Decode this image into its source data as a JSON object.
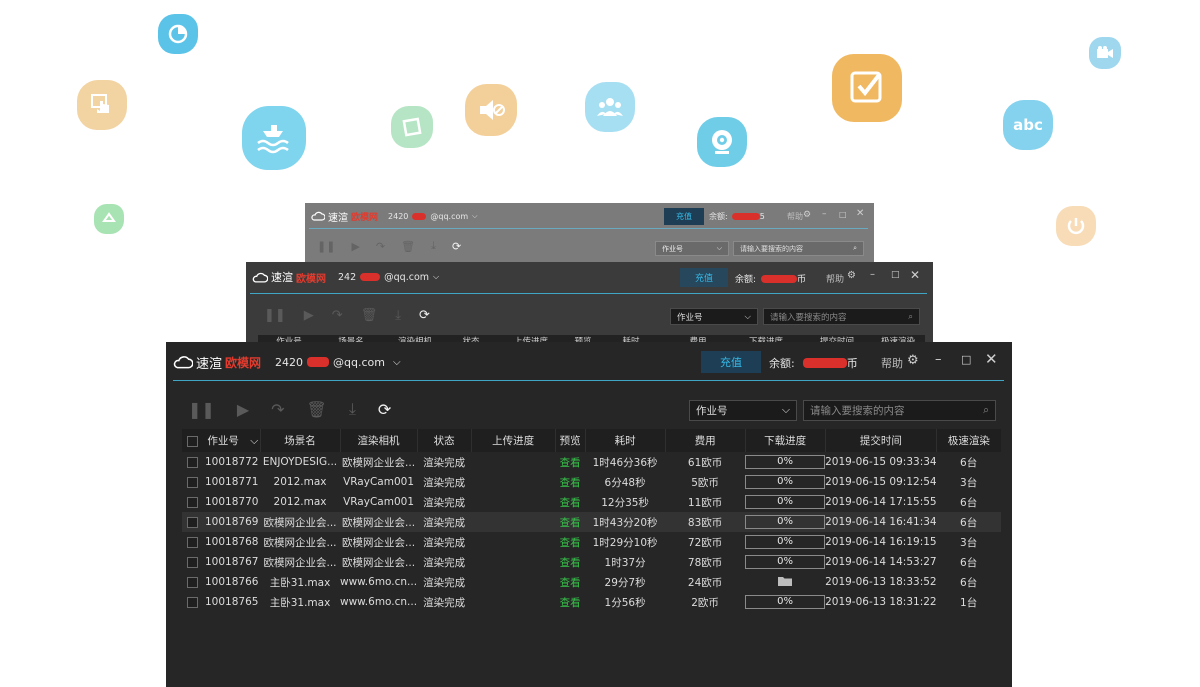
{
  "colors": {
    "recharge_text": "#37b9e8",
    "preview_green": "#37c24a",
    "accent_line": "#3fa6c6",
    "logo_red": "#e23b2e"
  },
  "floating_icons": [
    {
      "name": "pie-chart-icon",
      "color": "#5bc3e8"
    },
    {
      "name": "touch-hand-icon",
      "color": "#f2d3a2"
    },
    {
      "name": "ship-waves-icon",
      "color": "#7fd4ee"
    },
    {
      "name": "document-icon",
      "color": "#b5e5c4"
    },
    {
      "name": "mute-speaker-icon",
      "color": "#f3cf9a"
    },
    {
      "name": "users-group-icon",
      "color": "#a7dff2"
    },
    {
      "name": "webcam-icon",
      "color": "#6fcde8"
    },
    {
      "name": "checkbox-icon",
      "color": "#f0b860"
    },
    {
      "name": "abc-text-icon",
      "color": "#84d2ee"
    },
    {
      "name": "video-camera-icon",
      "color": "#9fd7ef"
    },
    {
      "name": "recycle-icon",
      "color": "#a8e3b3"
    },
    {
      "name": "power-icon",
      "color": "#f7dcb7"
    }
  ],
  "app": {
    "logo_text": "速渲",
    "brand_text": "欧模网",
    "account_prefix": "2420",
    "account_suffix": "@qq.com",
    "recharge_label": "充值",
    "balance_label": "余额:",
    "balance_unit_back": "5",
    "balance_unit": "币",
    "help_label": "帮助"
  },
  "back1": {
    "account_prefix": "242",
    "account_suffix": "@qq.com",
    "balance_unit": "币",
    "headers": [
      "作业号",
      "场景名",
      "渲染相机",
      "状态",
      "上传进度",
      "预览",
      "耗时",
      "费用",
      "下载进度",
      "提交时间",
      "极速渲染"
    ]
  },
  "filter": {
    "select_value": "作业号",
    "search_placeholder": "请输入要搜索的内容"
  },
  "table": {
    "headers": [
      "作业号",
      "场景名",
      "渲染相机",
      "状态",
      "上传进度",
      "预览",
      "耗时",
      "费用",
      "下载进度",
      "提交时间",
      "极速渲染"
    ],
    "rows": [
      {
        "id": "10018772",
        "scene": "ENJOYDESIG...",
        "camera": "欧模网企业会...",
        "status": "渲染完成",
        "upload": "",
        "preview": "查看",
        "elapsed": "1时46分36秒",
        "cost": "61欧币",
        "download": "0%",
        "submitted": "2019-06-15 09:33:34",
        "fast": "6台"
      },
      {
        "id": "10018771",
        "scene": "2012.max",
        "camera": "VRayCam001",
        "status": "渲染完成",
        "upload": "",
        "preview": "查看",
        "elapsed": "6分48秒",
        "cost": "5欧币",
        "download": "0%",
        "submitted": "2019-06-15 09:12:54",
        "fast": "3台"
      },
      {
        "id": "10018770",
        "scene": "2012.max",
        "camera": "VRayCam001",
        "status": "渲染完成",
        "upload": "",
        "preview": "查看",
        "elapsed": "12分35秒",
        "cost": "11欧币",
        "download": "0%",
        "submitted": "2019-06-14 17:15:55",
        "fast": "6台"
      },
      {
        "id": "10018769",
        "scene": "欧模网企业会...",
        "camera": "欧模网企业会...",
        "status": "渲染完成",
        "upload": "",
        "preview": "查看",
        "elapsed": "1时43分20秒",
        "cost": "83欧币",
        "download": "0%",
        "submitted": "2019-06-14 16:41:34",
        "fast": "6台"
      },
      {
        "id": "10018768",
        "scene": "欧模网企业会...",
        "camera": "欧模网企业会...",
        "status": "渲染完成",
        "upload": "",
        "preview": "查看",
        "elapsed": "1时29分10秒",
        "cost": "72欧币",
        "download": "0%",
        "submitted": "2019-06-14 16:19:15",
        "fast": "3台"
      },
      {
        "id": "10018767",
        "scene": "欧模网企业会...",
        "camera": "欧模网企业会...",
        "status": "渲染完成",
        "upload": "",
        "preview": "查看",
        "elapsed": "1时37分",
        "cost": "78欧币",
        "download": "0%",
        "submitted": "2019-06-14 14:53:27",
        "fast": "6台"
      },
      {
        "id": "10018766",
        "scene": "主卧31.max",
        "camera": "www.6mo.cn...",
        "status": "渲染完成",
        "upload": "",
        "preview": "查看",
        "elapsed": "29分7秒",
        "cost": "24欧币",
        "download": "",
        "submitted": "2019-06-13 18:33:52",
        "fast": "6台"
      },
      {
        "id": "10018765",
        "scene": "主卧31.max",
        "camera": "www.6mo.cn...",
        "status": "渲染完成",
        "upload": "",
        "preview": "查看",
        "elapsed": "1分56秒",
        "cost": "2欧币",
        "download": "0%",
        "submitted": "2019-06-13 18:31:22",
        "fast": "1台"
      }
    ]
  }
}
